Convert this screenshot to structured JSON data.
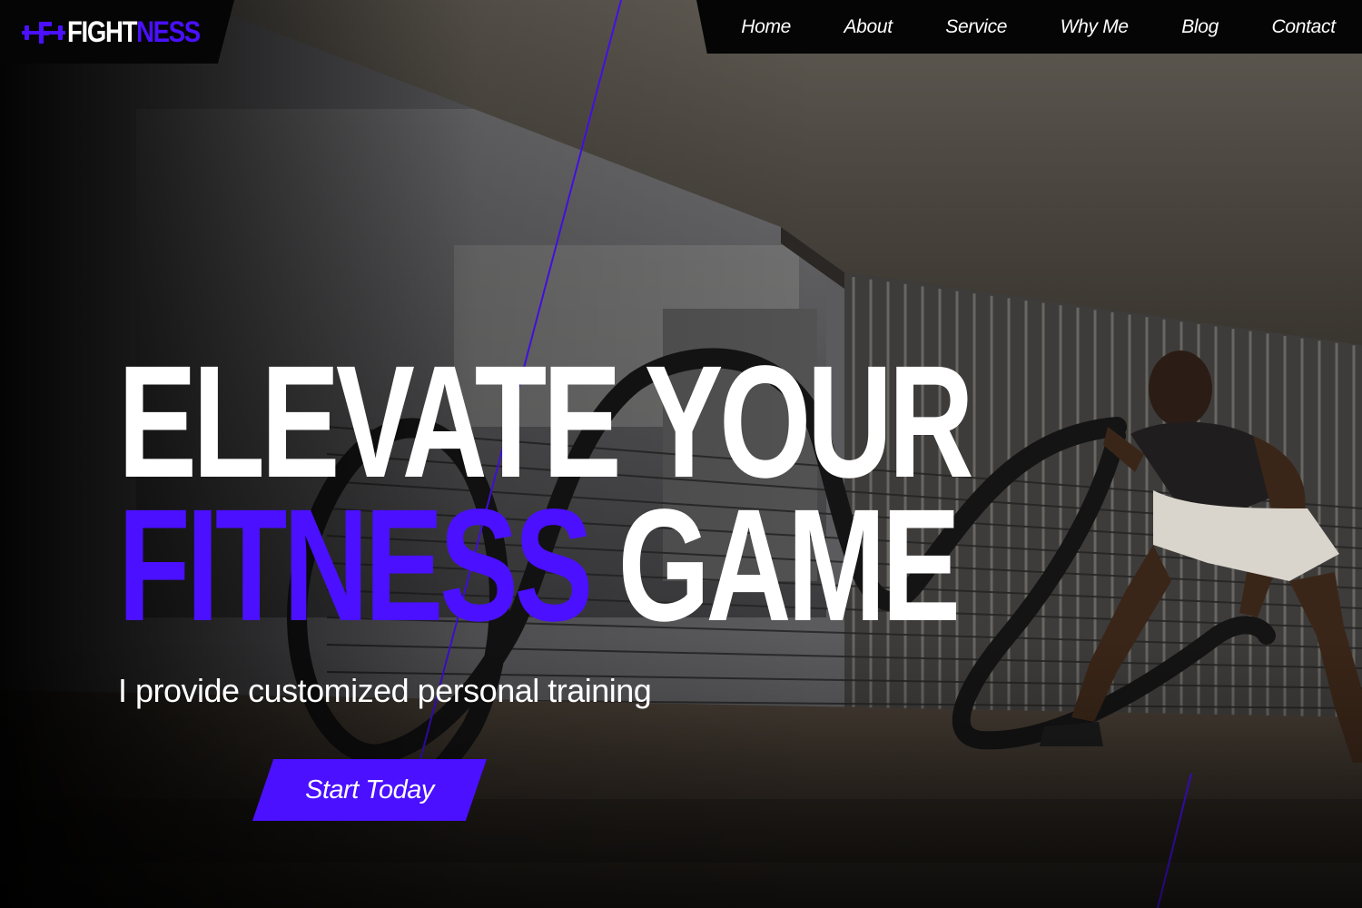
{
  "brand": {
    "name_part1": "FIGHT",
    "name_part2": "NESS",
    "logo_icon": "f-dumbbell-icon"
  },
  "nav": {
    "items": [
      {
        "label": "Home"
      },
      {
        "label": "About"
      },
      {
        "label": "Service"
      },
      {
        "label": "Why Me"
      },
      {
        "label": "Blog"
      },
      {
        "label": "Contact"
      }
    ]
  },
  "hero": {
    "headline_line1": "ELEVATE YOUR",
    "headline_accent": "FITNESS",
    "headline_line2_rest": "GAME",
    "subtitle": "I provide customized personal training",
    "cta_label": "Start Today",
    "background_image": "athlete-battle-ropes-photo"
  },
  "colors": {
    "accent": "#4a10ff",
    "text": "#ffffff",
    "nav_background": "#050505"
  }
}
